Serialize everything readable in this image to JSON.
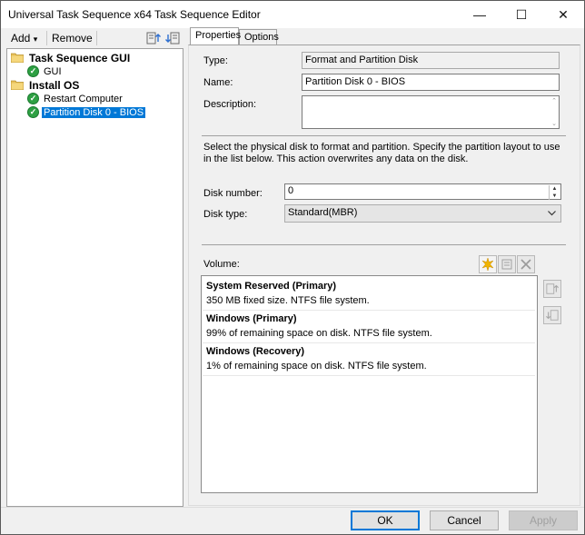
{
  "window": {
    "title": "Universal Task Sequence x64 Task Sequence Editor",
    "minimize_glyph": "—",
    "maximize_glyph": "☐",
    "close_glyph": "✕"
  },
  "toolbar": {
    "add_label": "Add",
    "add_arrow": "▾",
    "remove_label": "Remove"
  },
  "tree": {
    "items": [
      {
        "label": "Task Sequence GUI",
        "icon": "folder-icon"
      },
      {
        "label": "GUI",
        "icon": "check-icon"
      },
      {
        "label": "Install OS",
        "icon": "folder-icon"
      },
      {
        "label": "Restart Computer",
        "icon": "check-icon"
      },
      {
        "label": "Partition Disk 0 - BIOS",
        "icon": "check-icon"
      }
    ]
  },
  "tabs": {
    "properties": "Properties",
    "options": "Options"
  },
  "form": {
    "type_label": "Type:",
    "type_value": "Format and Partition Disk",
    "name_label": "Name:",
    "name_value": "Partition Disk 0 - BIOS",
    "description_label": "Description:",
    "description_value": "",
    "instructions": "Select the physical disk to format and partition. Specify the partition layout to use in the list below. This action overwrites any data on the disk.",
    "disk_number_label": "Disk number:",
    "disk_number_value": "0",
    "disk_type_label": "Disk type:",
    "disk_type_value": "Standard(MBR)",
    "volume_label": "Volume:"
  },
  "volumes": [
    {
      "title": "System Reserved (Primary)",
      "detail": "350 MB fixed size. NTFS file system."
    },
    {
      "title": "Windows (Primary)",
      "detail": "99% of remaining space on disk. NTFS file system."
    },
    {
      "title": "Windows (Recovery)",
      "detail": "1% of remaining space on disk. NTFS file system."
    }
  ],
  "buttons": {
    "ok": "OK",
    "cancel": "Cancel",
    "apply": "Apply"
  },
  "colors": {
    "selection": "#0078d7",
    "check_green": "#2ea043",
    "folder_yellow": "#e8c15a"
  }
}
